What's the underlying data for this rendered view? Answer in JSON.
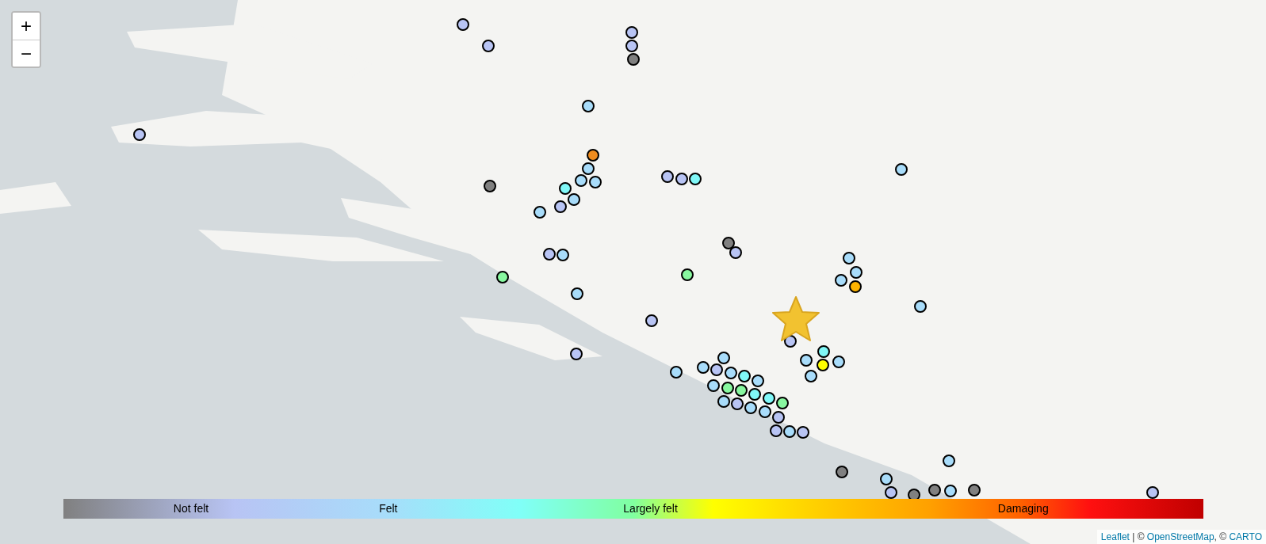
{
  "zoom_controls": [
    {
      "kind": "in",
      "label": "+"
    },
    {
      "kind": "out",
      "label": "−"
    }
  ],
  "markers": [
    {
      "kind": "station",
      "color": "#b8c4f4"
    },
    {
      "kind": "station",
      "color": "#b8c4f4"
    },
    {
      "kind": "station",
      "color": "#b8c4f4"
    },
    {
      "kind": "station",
      "color": "#808080"
    },
    {
      "kind": "station",
      "color": "#b8c4f4"
    },
    {
      "kind": "station",
      "color": "#a8dcfa"
    },
    {
      "kind": "station",
      "color": "#b8c4f4"
    },
    {
      "kind": "station",
      "color": "#f08c1e"
    },
    {
      "kind": "station",
      "color": "#a8dcfa"
    },
    {
      "kind": "station",
      "color": "#a8dcfa"
    },
    {
      "kind": "station",
      "color": "#a8dcfa"
    },
    {
      "kind": "station",
      "color": "#808080"
    },
    {
      "kind": "station",
      "color": "#80f8f8"
    },
    {
      "kind": "station",
      "color": "#a8dcfa"
    },
    {
      "kind": "station",
      "color": "#b8c4f4"
    },
    {
      "kind": "station",
      "color": "#a8dcfa"
    },
    {
      "kind": "station",
      "color": "#b8c4f4"
    },
    {
      "kind": "station",
      "color": "#80f8f8"
    },
    {
      "kind": "station",
      "color": "#b8c4f4"
    },
    {
      "kind": "station",
      "color": "#a8dcfa"
    },
    {
      "kind": "station",
      "color": "#808080"
    },
    {
      "kind": "station",
      "color": "#b8c4f4"
    },
    {
      "kind": "station",
      "color": "#b8c4f4"
    },
    {
      "kind": "station",
      "color": "#a8dcfa"
    },
    {
      "kind": "station",
      "color": "#a8dcfa"
    },
    {
      "kind": "station",
      "color": "#88f8a0"
    },
    {
      "kind": "station",
      "color": "#88f8a0"
    },
    {
      "kind": "station",
      "color": "#a8dcfa"
    },
    {
      "kind": "station",
      "color": "#a8dcfa"
    },
    {
      "kind": "station",
      "color": "#ffb400"
    },
    {
      "kind": "station",
      "color": "#a8dcfa"
    },
    {
      "kind": "station",
      "color": "#a8dcfa"
    },
    {
      "kind": "station",
      "color": "#b8c4f4"
    },
    {
      "kind": "station",
      "color": "#b8c4f4"
    },
    {
      "kind": "station",
      "color": "#b8c4f4"
    },
    {
      "kind": "station",
      "color": "#a8dcfa"
    },
    {
      "kind": "station",
      "color": "#80f8f8"
    },
    {
      "kind": "station",
      "color": "#a8dcfa"
    },
    {
      "kind": "station",
      "color": "#a8dcfa"
    },
    {
      "kind": "station",
      "color": "#ffff00"
    },
    {
      "kind": "station",
      "color": "#a8dcfa"
    },
    {
      "kind": "station",
      "color": "#a8dcfa"
    },
    {
      "kind": "station",
      "color": "#a8dcfa"
    },
    {
      "kind": "station",
      "color": "#b8c4f4"
    },
    {
      "kind": "station",
      "color": "#a8dcfa"
    },
    {
      "kind": "station",
      "color": "#80f8f8"
    },
    {
      "kind": "station",
      "color": "#a8dcfa"
    },
    {
      "kind": "station",
      "color": "#a8dcfa"
    },
    {
      "kind": "station",
      "color": "#88f8a0"
    },
    {
      "kind": "station",
      "color": "#88f8a0"
    },
    {
      "kind": "station",
      "color": "#80f8f8"
    },
    {
      "kind": "station",
      "color": "#a8dcfa"
    },
    {
      "kind": "station",
      "color": "#b8c4f4"
    },
    {
      "kind": "station",
      "color": "#80f8f8"
    },
    {
      "kind": "station",
      "color": "#a8dcfa"
    },
    {
      "kind": "station",
      "color": "#88f8a0"
    },
    {
      "kind": "station",
      "color": "#a8dcfa"
    },
    {
      "kind": "station",
      "color": "#b8c4f4"
    },
    {
      "kind": "station",
      "color": "#b8c4f4"
    },
    {
      "kind": "station",
      "color": "#a8dcfa"
    },
    {
      "kind": "station",
      "color": "#b8c4f4"
    },
    {
      "kind": "station",
      "color": "#a8dcfa"
    },
    {
      "kind": "station",
      "color": "#808080"
    },
    {
      "kind": "station",
      "color": "#a8dcfa"
    },
    {
      "kind": "station",
      "color": "#b8c4f4"
    },
    {
      "kind": "station",
      "color": "#808080"
    },
    {
      "kind": "station",
      "color": "#808080"
    },
    {
      "kind": "station",
      "color": "#a8dcfa"
    },
    {
      "kind": "station",
      "color": "#808080"
    },
    {
      "kind": "station",
      "color": "#b8c4f4"
    },
    {
      "kind": "epicenter"
    }
  ],
  "legend": {
    "labels": [
      "Not felt",
      "Felt",
      "Largely felt",
      "Damaging"
    ]
  },
  "attribution": [
    {
      "kind": "link",
      "text": "Leaflet"
    },
    {
      "kind": "text",
      "text": " | © "
    },
    {
      "kind": "link",
      "text": "OpenStreetMap"
    },
    {
      "kind": "text",
      "text": ", © "
    },
    {
      "kind": "link",
      "text": "CARTO"
    }
  ]
}
